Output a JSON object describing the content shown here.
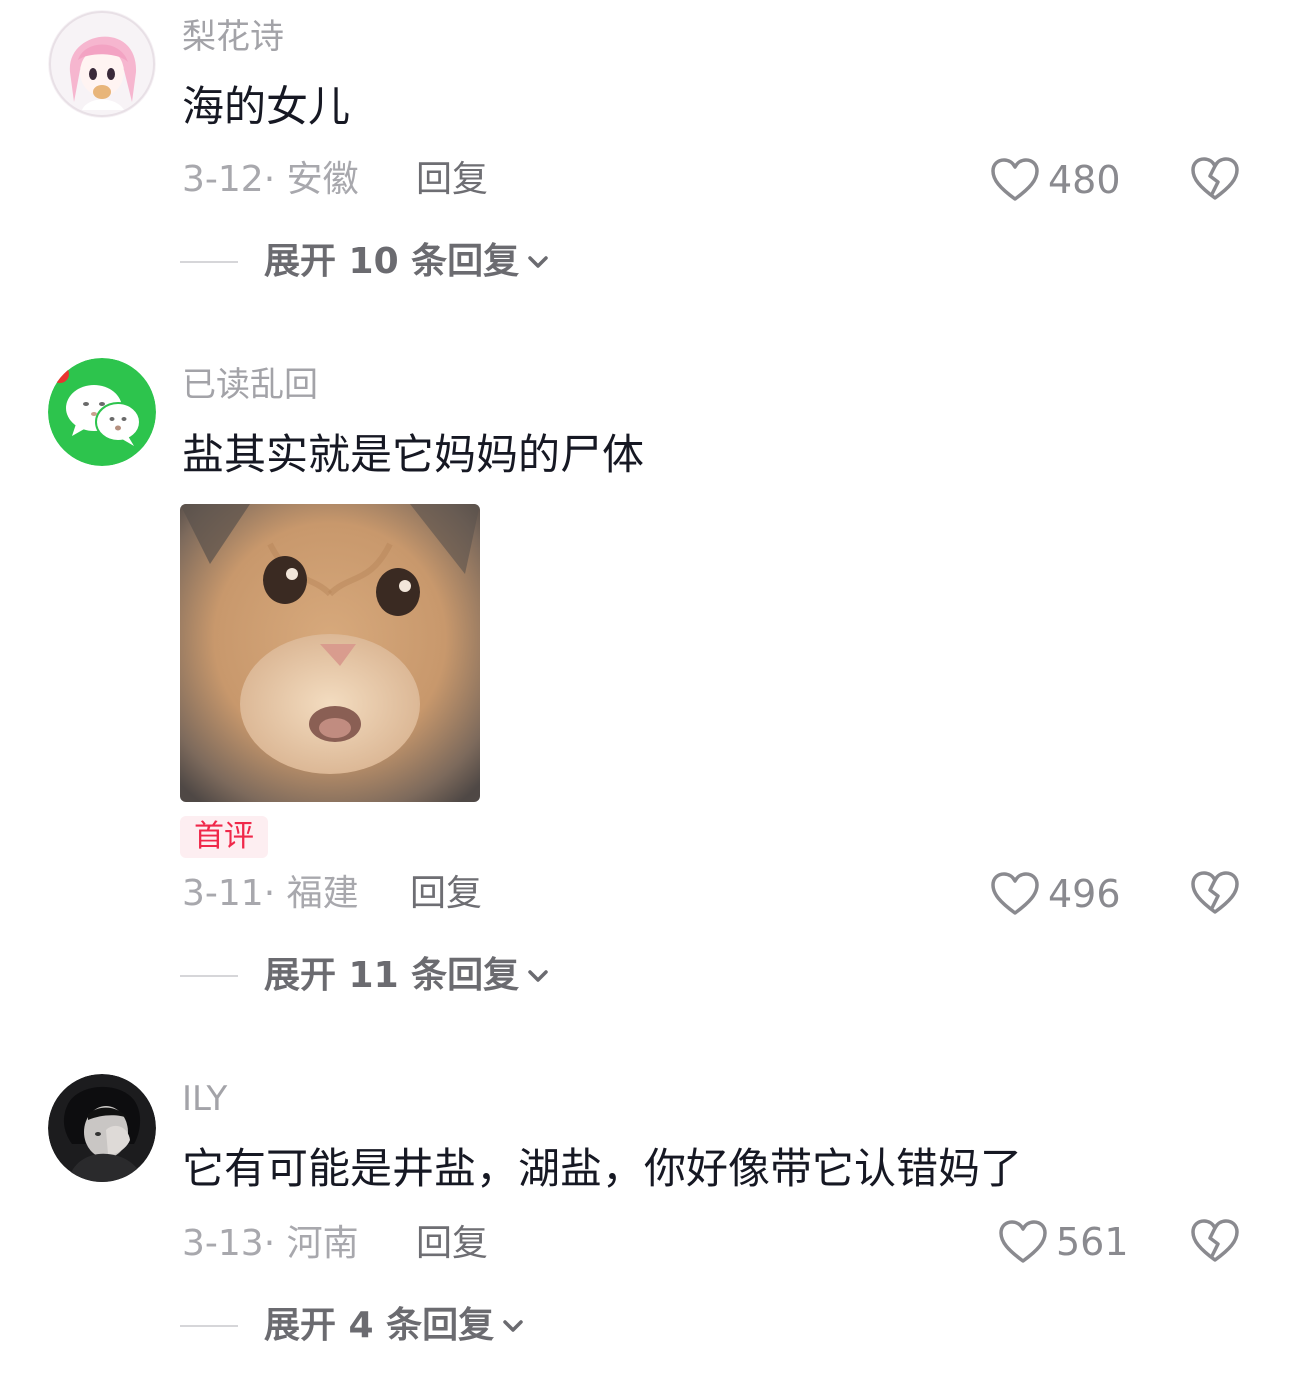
{
  "comments": [
    {
      "username": "梨花诗",
      "text": "海的女儿",
      "date_location": "3-12· 安徽",
      "reply_label": "回复",
      "likes": "480",
      "expand_label": "展开 10 条回复",
      "avatar_icon": "anime-girl-avatar-icon"
    },
    {
      "username": "已读乱回",
      "text": "盐其实就是它妈妈的尸体",
      "badge": "首评",
      "date_location": "3-11· 福建",
      "reply_label": "回复",
      "likes": "496",
      "expand_label": "展开 11 条回复",
      "avatar_icon": "wechat-style-avatar-icon",
      "sticker": "surprised-cat-sticker"
    },
    {
      "username": "ILY",
      "text": "它有可能是井盐，湖盐，你好像带它认错妈了",
      "date_location": "3-13· 河南",
      "reply_label": "回复",
      "likes": "561",
      "expand_label": "展开 4 条回复",
      "avatar_icon": "dark-portrait-avatar-icon"
    }
  ],
  "colors": {
    "text_primary": "#161823",
    "text_secondary": "#a8a8ad",
    "badge_red": "#f0284a",
    "badge_bg": "#fdeef1",
    "wechat_green": "#2dc44d"
  }
}
